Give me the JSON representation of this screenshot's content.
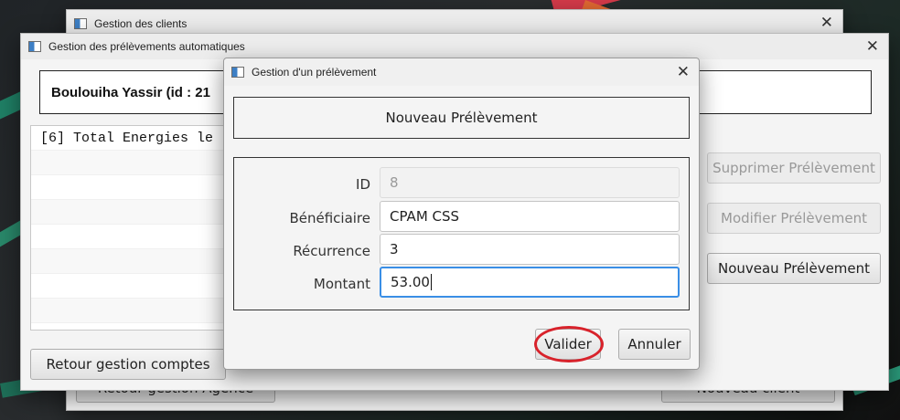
{
  "clients_window": {
    "title": "Gestion des clients",
    "back_button": "Retour gestion Agence",
    "new_client_button": "Nouveau client"
  },
  "prelevements_window": {
    "title": "Gestion des prélèvements automatiques",
    "client_header": "Boulouiha  Yassir  (id : 21",
    "list_items": [
      "[6] Total Energies le"
    ],
    "buttons": {
      "supprimer": "Supprimer Prélèvement",
      "modifier": "Modifier Prélèvement",
      "nouveau": "Nouveau Prélèvement",
      "retour": "Retour gestion comptes"
    }
  },
  "dialog": {
    "title": "Gestion d'un prélèvement",
    "header": "Nouveau Prélèvement",
    "fields": {
      "id": {
        "label": "ID",
        "value": "8"
      },
      "beneficiaire": {
        "label": "Bénéficiaire",
        "value": "CPAM CSS"
      },
      "recurrence": {
        "label": "Récurrence",
        "value": "3"
      },
      "montant": {
        "label": "Montant",
        "value": "53.00"
      }
    },
    "valider_button": "Valider",
    "annuler_button": "Annuler"
  },
  "colors": {
    "highlight": "#d8222b",
    "focus": "#3a8ee6"
  }
}
